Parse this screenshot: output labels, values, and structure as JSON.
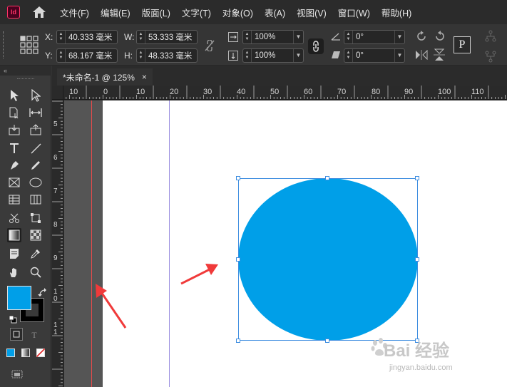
{
  "app": {
    "logo_text": "Id"
  },
  "menu": [
    "文件(F)",
    "编辑(E)",
    "版面(L)",
    "文字(T)",
    "对象(O)",
    "表(A)",
    "视图(V)",
    "窗口(W)",
    "帮助(H)"
  ],
  "control": {
    "x_label": "X:",
    "x_value": "40.333 毫米",
    "y_label": "Y:",
    "y_value": "68.167 毫米",
    "w_label": "W:",
    "w_value": "53.333 毫米",
    "h_label": "H:",
    "h_value": "48.333 毫米",
    "scale_x": "100%",
    "scale_y": "100%",
    "rotate": "0°",
    "shear": "0°",
    "p_button": "P"
  },
  "document": {
    "tab_title": "*未命名-1 @ 125%",
    "close_glyph": "×"
  },
  "ruler": {
    "h_labels": [
      "10",
      "0",
      "10",
      "20",
      "30",
      "40",
      "50",
      "60",
      "70",
      "80",
      "90",
      "100",
      "110"
    ],
    "v_labels": [
      "5",
      "6",
      "7",
      "8",
      "9",
      "1\n0",
      "1\n1"
    ]
  },
  "swatch": {
    "fill_color": "#009fe8",
    "stroke_color": "#000000"
  },
  "shape": {
    "fill_color": "#009fe8",
    "frame_color": "#3d8de0"
  },
  "watermark": {
    "main": "Bai 经验",
    "sub": "jingyan.baidu.com"
  }
}
